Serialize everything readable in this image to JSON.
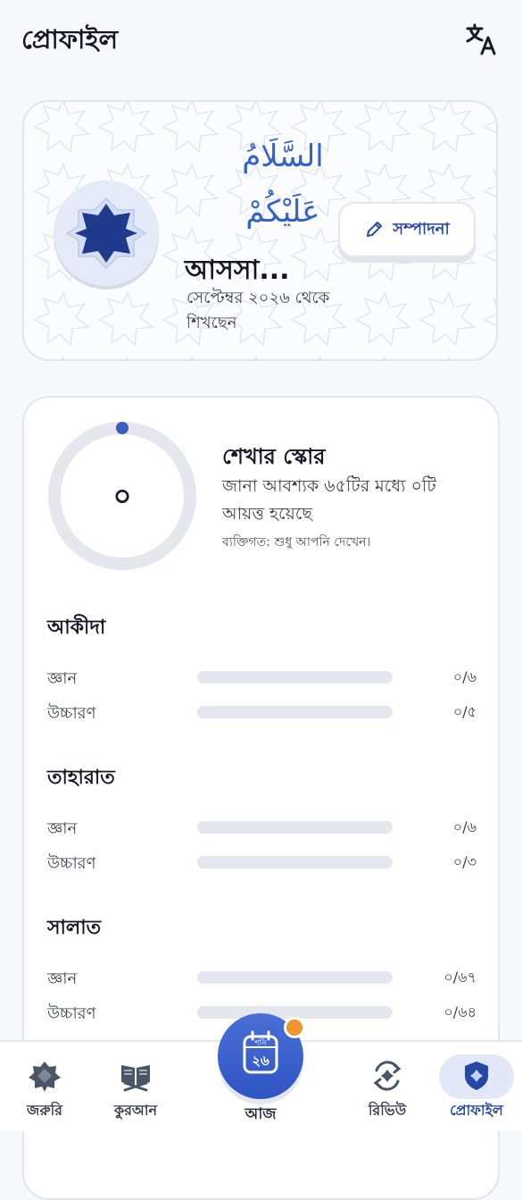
{
  "header": {
    "title": "প্রোফাইল",
    "translate_icon": "translate-icon"
  },
  "profile": {
    "greeting_line1": "السَّلَامُ",
    "greeting_line2": "عَلَيْكُمْ",
    "name": "আসসা...",
    "since": "সেপ্টেম্বর ২০২৬ থেকে শিখছেন",
    "edit_label": "সম্পাদনা"
  },
  "score": {
    "value": "০",
    "progress": 0,
    "title": "শেখার স্কোর",
    "description": "জানা আবশ্যক ৬৫টির মধ্যে ০টি আয়ত্ত হয়েছে",
    "note": "ব্যক্তিগত: শুধু আপনি দেখেন।"
  },
  "sections": [
    {
      "title": "আকীদা",
      "rows": [
        {
          "label": "জ্ঞান",
          "count": "০/৬",
          "fraction": 0
        },
        {
          "label": "উচ্চারণ",
          "count": "০/৫",
          "fraction": 0
        }
      ]
    },
    {
      "title": "তাহারাত",
      "rows": [
        {
          "label": "জ্ঞান",
          "count": "০/৬",
          "fraction": 0
        },
        {
          "label": "উচ্চারণ",
          "count": "০/৩",
          "fraction": 0
        }
      ]
    },
    {
      "title": "সালাত",
      "rows": [
        {
          "label": "জ্ঞান",
          "count": "০/৬৭",
          "fraction": 0
        },
        {
          "label": "উচ্চারণ",
          "count": "০/৬৪",
          "fraction": 0
        }
      ]
    }
  ],
  "nav": {
    "items": [
      {
        "label": "জরুরি",
        "icon": "star-badge-icon"
      },
      {
        "label": "কুরআন",
        "icon": "quran-icon"
      },
      {
        "label": "আজ",
        "icon": "calendar-icon",
        "calendar_month": "শনি",
        "calendar_day": "২৬"
      },
      {
        "label": "রিভিউ",
        "icon": "review-icon"
      },
      {
        "label": "প্রোফাইল",
        "icon": "shield-icon"
      }
    ],
    "active": "প্রোফাইল",
    "accent": "#2f55c2",
    "notification_color": "#f29430"
  }
}
